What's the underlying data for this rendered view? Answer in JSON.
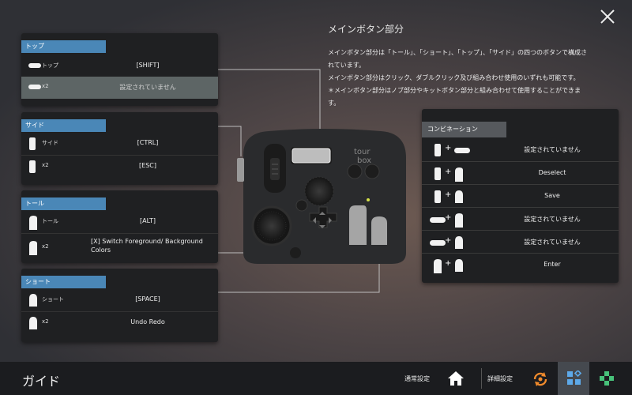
{
  "info": {
    "title": "メインボタン部分",
    "lines": [
      "メインボタン部分は「トール」、「ショート」、「トップ」、「サイド」の四つのボタンで構成さ",
      "れています。",
      "メインボタン部分はクリック、ダブルクリック及び組み合わせ使用のいずれも可能です。",
      "＊メインボタン部分はノブ部分やキットボタン部分と組み合わせて使用することができます。"
    ]
  },
  "panels": {
    "top": {
      "tag": "トップ",
      "rows": [
        {
          "label": "トップ",
          "value": "[SHIFT]"
        },
        {
          "label": "x2",
          "value": "設定されていません"
        }
      ]
    },
    "side": {
      "tag": "サイド",
      "rows": [
        {
          "label": "サイド",
          "value": "[CTRL]"
        },
        {
          "label": "x2",
          "value": "[ESC]"
        }
      ]
    },
    "tall": {
      "tag": "トール",
      "rows": [
        {
          "label": "トール",
          "value": "[ALT]"
        },
        {
          "label": "x2",
          "value": "[X] Switch Foreground/ Background Colors"
        }
      ]
    },
    "short": {
      "tag": "ショート",
      "rows": [
        {
          "label": "ショート",
          "value": "[SPACE]"
        },
        {
          "label": "x2",
          "value": "Undo  Redo"
        }
      ]
    }
  },
  "combo": {
    "tag": "コンビネーション",
    "rows": [
      {
        "value": "設定されていません"
      },
      {
        "value": "Deselect"
      },
      {
        "value": "Save"
      },
      {
        "value": "設定されていません"
      },
      {
        "value": "設定されていません"
      },
      {
        "value": "Enter"
      }
    ]
  },
  "device": {
    "logo_line1": "tour",
    "logo_line2": "box"
  },
  "bottom": {
    "title": "ガイド",
    "normal_settings": "通常設定",
    "advanced_settings": "詳細設定"
  },
  "colors": {
    "tag_blue": "#4a87b7",
    "panel_bg": "#1f2022",
    "selected_row": "#5d6565"
  }
}
